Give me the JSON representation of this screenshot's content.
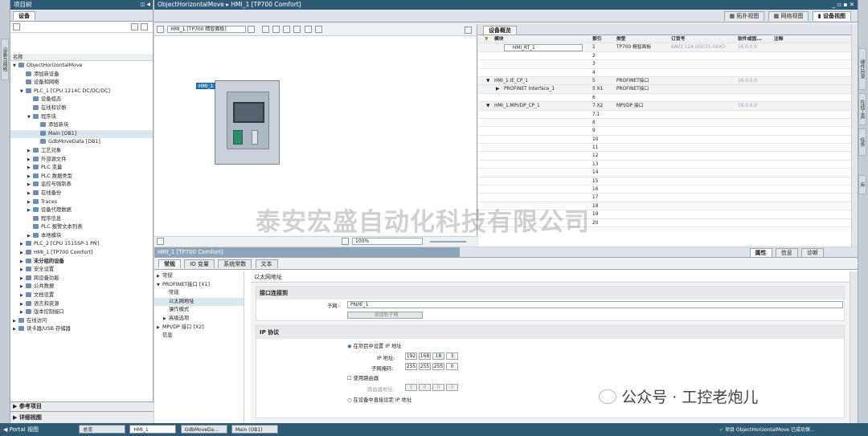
{
  "project_tree": {
    "title": "项目树",
    "tab": "设备",
    "header": "名称",
    "items": [
      {
        "label": "ObjectHorizontalMove",
        "level": 0,
        "arrow": "▼",
        "style": ""
      },
      {
        "label": "添加新设备",
        "level": 1,
        "arrow": "",
        "style": ""
      },
      {
        "label": "设备和网络",
        "level": 1,
        "arrow": "",
        "style": ""
      },
      {
        "label": "PLC_1 [CPU 1214C DC/DC/DC]",
        "level": 1,
        "arrow": "▼",
        "style": ""
      },
      {
        "label": "设备组态",
        "level": 2,
        "arrow": "",
        "style": ""
      },
      {
        "label": "在线和诊断",
        "level": 2,
        "arrow": "",
        "style": ""
      },
      {
        "label": "程序块",
        "level": 2,
        "arrow": "▼",
        "style": ""
      },
      {
        "label": "添加新块",
        "level": 3,
        "arrow": "",
        "style": ""
      },
      {
        "label": "Main [OB1]",
        "level": 3,
        "arrow": "",
        "style": "sel"
      },
      {
        "label": "GdbMoveData [DB1]",
        "level": 3,
        "arrow": "",
        "style": ""
      },
      {
        "label": "工艺对象",
        "level": 2,
        "arrow": "▶",
        "style": ""
      },
      {
        "label": "外部源文件",
        "level": 2,
        "arrow": "▶",
        "style": ""
      },
      {
        "label": "PLC 变量",
        "level": 2,
        "arrow": "▶",
        "style": ""
      },
      {
        "label": "PLC 数据类型",
        "level": 2,
        "arrow": "▶",
        "style": ""
      },
      {
        "label": "监控与强制表",
        "level": 2,
        "arrow": "▶",
        "style": ""
      },
      {
        "label": "在线备份",
        "level": 2,
        "arrow": "▶",
        "style": ""
      },
      {
        "label": "Traces",
        "level": 2,
        "arrow": "▶",
        "style": ""
      },
      {
        "label": "设备代理数据",
        "level": 2,
        "arrow": "▶",
        "style": ""
      },
      {
        "label": "程序信息",
        "level": 2,
        "arrow": "",
        "style": ""
      },
      {
        "label": "PLC 报警文本列表",
        "level": 2,
        "arrow": "",
        "style": ""
      },
      {
        "label": "本地模块",
        "level": 2,
        "arrow": "▶",
        "style": ""
      },
      {
        "label": "PLC_2 [CPU 1515SP-1 PN]",
        "level": 1,
        "arrow": "▶",
        "style": ""
      },
      {
        "label": "HMI_1 [TP700 Comfort]",
        "level": 1,
        "arrow": "▶",
        "style": ""
      },
      {
        "label": "未分组的设备",
        "level": 1,
        "arrow": "▶",
        "style": "bold"
      },
      {
        "label": "安全设置",
        "level": 1,
        "arrow": "▶",
        "style": ""
      },
      {
        "label": "跨设备功能",
        "level": 1,
        "arrow": "▶",
        "style": ""
      },
      {
        "label": "公共数据",
        "level": 1,
        "arrow": "▶",
        "style": ""
      },
      {
        "label": "文档设置",
        "level": 1,
        "arrow": "▶",
        "style": ""
      },
      {
        "label": "语言和资源",
        "level": 1,
        "arrow": "▶",
        "style": ""
      },
      {
        "label": "版本控制接口",
        "level": 1,
        "arrow": "▶",
        "style": ""
      },
      {
        "label": "在线访问",
        "level": 0,
        "arrow": "▶",
        "style": ""
      },
      {
        "label": "读卡器/USB 存储器",
        "level": 0,
        "arrow": "▶",
        "style": ""
      }
    ],
    "bottom_sections": [
      "参考项目",
      "详细视图"
    ]
  },
  "left_sidebar_tab": "设备与网络",
  "editor": {
    "breadcrumb": [
      "ObjectHorizontalMove",
      "HMI_1 [TP700 Comfort]"
    ],
    "view_tabs": [
      "拓扑视图",
      "网络视图",
      "设备视图"
    ],
    "device_select": "HMI_1 [TP700 精智面板]",
    "device_label": "HMI_1",
    "zoom": "100%"
  },
  "device_overview": {
    "tab": "设备概览",
    "columns": [
      "模块",
      "索引",
      "类型",
      "订货号",
      "软件或固...",
      "注释"
    ],
    "rows": [
      {
        "module": "HMI_RT_1",
        "index": "1",
        "type": "TP700 精智面板",
        "order": "6AV2 124-0GC01-0AX0",
        "fw": "16.0.0.0",
        "indent": 1,
        "arrow": ""
      },
      {
        "module": "",
        "index": "2",
        "type": "",
        "order": "",
        "fw": "",
        "indent": 0,
        "arrow": ""
      },
      {
        "module": "",
        "index": "3",
        "type": "",
        "order": "",
        "fw": "",
        "indent": 0,
        "arrow": ""
      },
      {
        "module": "",
        "index": "4",
        "type": "",
        "order": "",
        "fw": "",
        "indent": 0,
        "arrow": ""
      },
      {
        "module": "HMI_1.IE_CP_1",
        "index": "5",
        "type": "PROFINET接口",
        "order": "",
        "fw": "16.0.0.0",
        "indent": 0,
        "arrow": "▼"
      },
      {
        "module": "PROFINET Interface_1",
        "index": "5 X1",
        "type": "PROFINET接口",
        "order": "",
        "fw": "",
        "indent": 1,
        "arrow": "▶"
      },
      {
        "module": "",
        "index": "6",
        "type": "",
        "order": "",
        "fw": "",
        "indent": 0,
        "arrow": ""
      },
      {
        "module": "HMI_1.MPI/DP_CP_1",
        "index": "7 X2",
        "type": "MPI/DP 接口",
        "order": "",
        "fw": "16.0.0.0",
        "indent": 0,
        "arrow": "▼"
      },
      {
        "module": "",
        "index": "7.1",
        "type": "",
        "order": "",
        "fw": "",
        "indent": 0,
        "arrow": ""
      },
      {
        "module": "",
        "index": "8",
        "type": "",
        "order": "",
        "fw": "",
        "indent": 0,
        "arrow": ""
      },
      {
        "module": "",
        "index": "9",
        "type": "",
        "order": "",
        "fw": "",
        "indent": 0,
        "arrow": ""
      },
      {
        "module": "",
        "index": "10",
        "type": "",
        "order": "",
        "fw": "",
        "indent": 0,
        "arrow": ""
      },
      {
        "module": "",
        "index": "11",
        "type": "",
        "order": "",
        "fw": "",
        "indent": 0,
        "arrow": ""
      },
      {
        "module": "",
        "index": "12",
        "type": "",
        "order": "",
        "fw": "",
        "indent": 0,
        "arrow": ""
      },
      {
        "module": "",
        "index": "13",
        "type": "",
        "order": "",
        "fw": "",
        "indent": 0,
        "arrow": ""
      },
      {
        "module": "",
        "index": "14",
        "type": "",
        "order": "",
        "fw": "",
        "indent": 0,
        "arrow": ""
      },
      {
        "module": "",
        "index": "15",
        "type": "",
        "order": "",
        "fw": "",
        "indent": 0,
        "arrow": ""
      },
      {
        "module": "",
        "index": "16",
        "type": "",
        "order": "",
        "fw": "",
        "indent": 0,
        "arrow": ""
      },
      {
        "module": "",
        "index": "17",
        "type": "",
        "order": "",
        "fw": "",
        "indent": 0,
        "arrow": ""
      },
      {
        "module": "",
        "index": "18",
        "type": "",
        "order": "",
        "fw": "",
        "indent": 0,
        "arrow": ""
      },
      {
        "module": "",
        "index": "19",
        "type": "",
        "order": "",
        "fw": "",
        "indent": 0,
        "arrow": ""
      },
      {
        "module": "",
        "index": "20",
        "type": "",
        "order": "",
        "fw": "",
        "indent": 0,
        "arrow": ""
      }
    ]
  },
  "properties": {
    "title": "HMI_1 [TP700 Comfort]",
    "top_tabs": [
      "属性",
      "信息",
      "诊断"
    ],
    "tabs": [
      "常规",
      "IO 变量",
      "系统常数",
      "文本"
    ],
    "nav": [
      {
        "label": "常规",
        "level": 0,
        "arrow": "▶"
      },
      {
        "label": "PROFINET接口 [X1]",
        "level": 0,
        "arrow": "▼"
      },
      {
        "label": "常规",
        "level": 1,
        "arrow": ""
      },
      {
        "label": "以太网地址",
        "level": 1,
        "arrow": ""
      },
      {
        "label": "操作模式",
        "level": 1,
        "arrow": ""
      },
      {
        "label": "高级选项",
        "level": 1,
        "arrow": "▶"
      },
      {
        "label": "MPI/DP 接口 [X2]",
        "level": 0,
        "arrow": "▶"
      },
      {
        "label": "信息",
        "level": 0,
        "arrow": ""
      }
    ],
    "section_title": "以太网地址",
    "interface_group": "接口连接到",
    "subnet_label": "子网:",
    "subnet_value": "PN/IE_1",
    "add_subnet": "添加新子网",
    "ip_group": "IP 协议",
    "radio_project": "在项目中设置 IP 地址",
    "ip_label": "IP 地址:",
    "ip": [
      "192",
      "168",
      "18",
      "3"
    ],
    "mask_label": "子网掩码:",
    "mask": [
      "255",
      "255",
      "255",
      "0"
    ],
    "router_check": "使用路由器",
    "router_label": "路由器地址:",
    "router": [
      "0",
      "0",
      "0",
      "0"
    ],
    "radio_device": "在设备中直接设定 IP 地址"
  },
  "right_sidebar_tabs": [
    "硬件目录",
    "在线工具",
    "任务",
    "库"
  ],
  "watermark": "泰安宏盛自动化科技有限公司",
  "wechat": "公众号 · 工控老炮儿",
  "taskbar": {
    "portal": "Portal 视图",
    "items": [
      "总览",
      "HMI_1",
      "GdbMoveDa...",
      "Main (OB1)"
    ],
    "status": "项目 ObjectHorizontalMove 已成功保..."
  }
}
